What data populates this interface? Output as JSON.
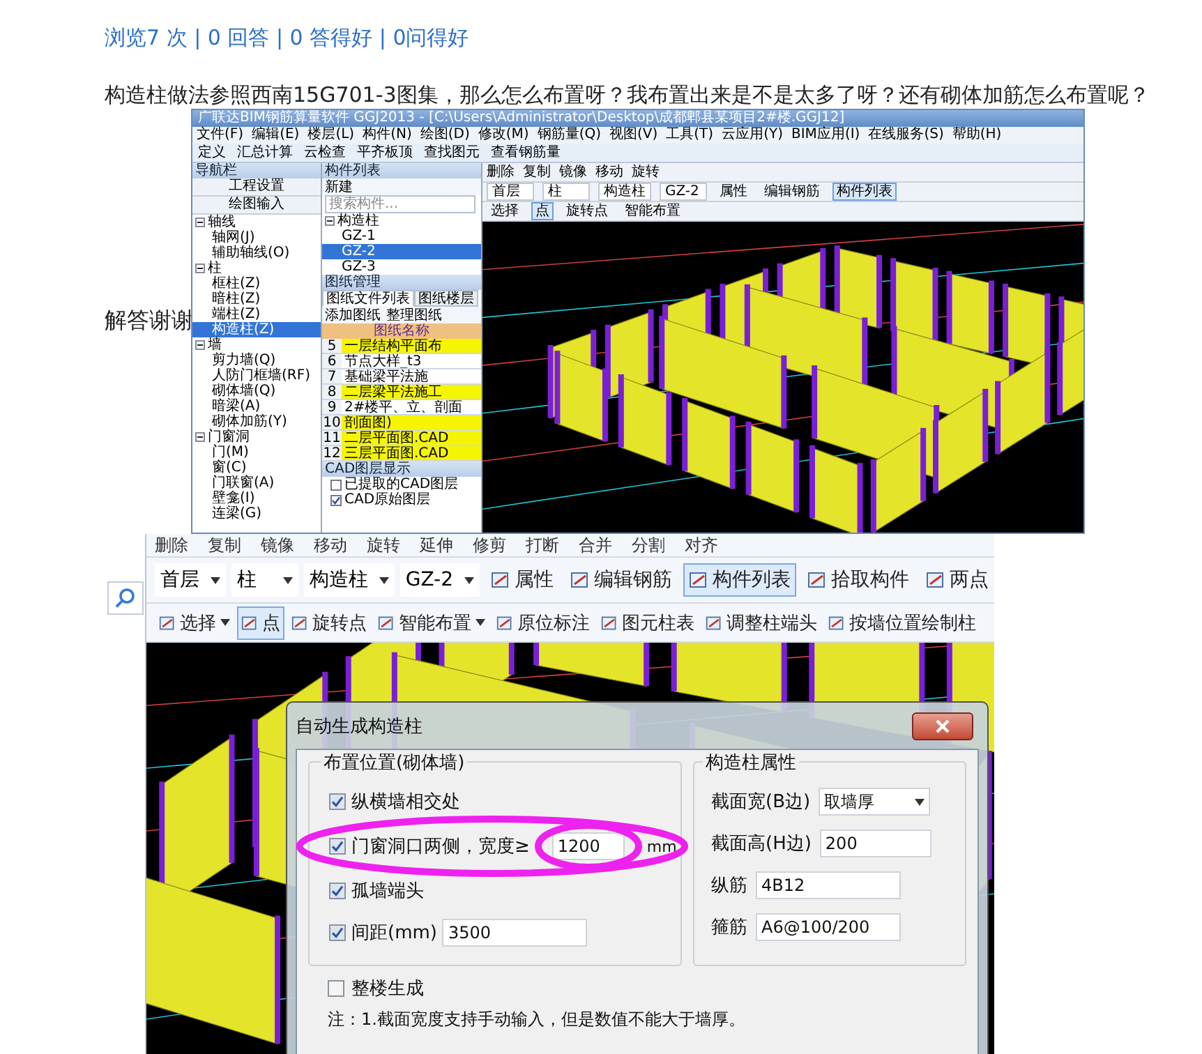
{
  "stats": "浏览7 次 | 0 回答 | 0 答得好 | 0问得好",
  "question": "构造柱做法参照西南15G701-3图集，那么怎么布置呀？我布置出来是不是太多了呀？还有砌体加筋怎么布置呢？",
  "body": "解答谢谢",
  "screenshot_1": {
    "title_bar": "广联达BIM钢筋算量软件 GGJ2013 - [C:\\Users\\Administrator\\Desktop\\成都郫县某项目2#楼.GGJ12]",
    "menu": [
      "文件(F)",
      "编辑(E)",
      "楼层(L)",
      "构件(N)",
      "绘图(D)",
      "修改(M)",
      "钢筋量(Q)",
      "视图(V)",
      "工具(T)",
      "云应用(Y)",
      "BIM应用(I)",
      "在线服务(S)",
      "帮助(H)"
    ],
    "toolbar": [
      "定义",
      "汇总计算",
      "云检查",
      "平齐板顶",
      "查找图元",
      "查看钢筋量"
    ],
    "nav_panel": {
      "title": "导航栏",
      "buttons": [
        "工程设置",
        "绘图输入"
      ],
      "tree": [
        {
          "label": "轴线",
          "expanded": true,
          "children": [
            {
              "label": "轴网(J)",
              "selected": false
            },
            {
              "label": "辅助轴线(O)",
              "selected": false
            }
          ]
        },
        {
          "label": "柱",
          "expanded": true,
          "children": [
            {
              "label": "框柱(Z)",
              "selected": false
            },
            {
              "label": "暗柱(Z)",
              "selected": false
            },
            {
              "label": "端柱(Z)",
              "selected": false
            },
            {
              "label": "构造柱(Z)",
              "selected": true
            }
          ]
        },
        {
          "label": "墙",
          "expanded": true,
          "children": [
            {
              "label": "剪力墙(Q)",
              "selected": false
            },
            {
              "label": "人防门框墙(RF)",
              "selected": false
            },
            {
              "label": "砌体墙(Q)",
              "selected": false
            },
            {
              "label": "暗梁(A)",
              "selected": false
            },
            {
              "label": "砌体加筋(Y)",
              "selected": false
            }
          ]
        },
        {
          "label": "门窗洞",
          "expanded": true,
          "children": [
            {
              "label": "门(M)",
              "selected": false
            },
            {
              "label": "窗(C)",
              "selected": false
            },
            {
              "label": "门联窗(A)",
              "selected": false
            },
            {
              "label": "壁龛(I)",
              "selected": false
            },
            {
              "label": "连梁(G)",
              "selected": false
            }
          ]
        }
      ]
    },
    "component_panel": {
      "title": "构件列表",
      "new_button": "新建",
      "search": {
        "placeholder": "搜索构件..."
      },
      "tree": [
        {
          "label": "构造柱",
          "expanded": true,
          "children": [
            {
              "label": "GZ-1",
              "selected": false
            },
            {
              "label": "GZ-2",
              "selected": true
            },
            {
              "label": "GZ-3",
              "selected": false
            }
          ]
        }
      ]
    },
    "drawing_panel": {
      "title": "图纸管理",
      "tabs": [
        {
          "label": "图纸文件列表",
          "selected": true
        },
        {
          "label": "图纸楼层",
          "selected": false
        }
      ],
      "buttons": [
        "添加图纸",
        "整理图纸"
      ],
      "column": "图纸名称",
      "rows": [
        {
          "number": "5",
          "name": "一层结构平面布",
          "highlighted": true
        },
        {
          "number": "6",
          "name": "节点大样_t3",
          "highlighted": false
        },
        {
          "number": "7",
          "name": "基础梁平法施",
          "highlighted": false
        },
        {
          "number": "8",
          "name": "二层梁平法施工",
          "highlighted": true
        },
        {
          "number": "9",
          "name": "2#楼平、立、剖面",
          "highlighted": false
        },
        {
          "number": "10",
          "name": "剖面图)",
          "highlighted": true
        },
        {
          "number": "11",
          "name": "二层平面图.CAD",
          "highlighted": true
        },
        {
          "number": "12",
          "name": "三层平面图.CAD",
          "highlighted": true
        }
      ]
    },
    "layer_panel": {
      "title": "CAD图层显示",
      "layers": [
        {
          "label": "已提取的CAD图层",
          "checked": false
        },
        {
          "label": "CAD原始图层",
          "checked": true
        }
      ]
    },
    "edit_toolbar": [
      "删除",
      "复制",
      "镜像",
      "移动",
      "旋转"
    ],
    "selectors": [
      "首层",
      "柱",
      "构造柱",
      "GZ-2"
    ],
    "buttons": [
      {
        "label": "属性",
        "selected": false
      },
      {
        "label": "编辑钢筋",
        "selected": false
      },
      {
        "label": "构件列表",
        "selected": true
      }
    ],
    "draw_toolbar": [
      {
        "label": "选择",
        "selected": false
      },
      {
        "label": "点",
        "selected": true
      },
      {
        "label": "旋转点",
        "selected": false
      },
      {
        "label": "智能布置",
        "selected": false
      }
    ]
  },
  "screenshot_2": {
    "edit_toolbar": [
      "删除",
      "复制",
      "镜像",
      "移动",
      "旋转",
      "延伸",
      "修剪",
      "打断",
      "合并",
      "分割",
      "对齐"
    ],
    "selectors": [
      "首层",
      "柱",
      "构造柱",
      "GZ-2"
    ],
    "buttons": [
      {
        "label": "属性",
        "selected": false
      },
      {
        "label": "编辑钢筋",
        "selected": false
      },
      {
        "label": "构件列表",
        "selected": true
      },
      {
        "label": "拾取构件",
        "selected": false
      },
      {
        "label": "两点",
        "selected": false
      }
    ],
    "draw_toolbar": [
      {
        "label": "选择",
        "selected": false,
        "dropdown": true
      },
      {
        "label": "点",
        "selected": true,
        "dropdown": false
      },
      {
        "label": "旋转点",
        "selected": false,
        "dropdown": false
      },
      {
        "label": "智能布置",
        "selected": false,
        "dropdown": true
      },
      {
        "label": "原位标注",
        "selected": false,
        "dropdown": false
      },
      {
        "label": "图元柱表",
        "selected": false,
        "dropdown": false
      },
      {
        "label": "调整柱端头",
        "selected": false,
        "dropdown": false
      },
      {
        "label": "按墙位置绘制柱",
        "selected": false,
        "dropdown": false
      }
    ],
    "dialog": {
      "title": "自动生成构造柱",
      "placement": {
        "legend": "布置位置(砌体墙)",
        "options": [
          {
            "label": "纵横墙相交处",
            "checked": true
          },
          {
            "label": "门窗洞口两侧，宽度≥",
            "checked": true,
            "value": "1200",
            "unit": "mm"
          },
          {
            "label": "孤墙端头",
            "checked": true
          },
          {
            "label": "间距(mm)",
            "checked": true,
            "value": "3500"
          }
        ]
      },
      "properties": {
        "legend": "构造柱属性",
        "fields": [
          {
            "label": "截面宽(B边)",
            "kind": "select",
            "value": "取墙厚"
          },
          {
            "label": "截面高(H边)",
            "kind": "input",
            "value": "200"
          },
          {
            "label": "纵筋",
            "kind": "input",
            "value": "4B12"
          },
          {
            "label": "箍筋",
            "kind": "input",
            "value": "A6@100/200"
          }
        ]
      },
      "whole_building": {
        "label": "整楼生成",
        "checked": false
      },
      "note": "注：1.截面宽度支持手动输入，但是数值不能大于墙厚。"
    }
  }
}
